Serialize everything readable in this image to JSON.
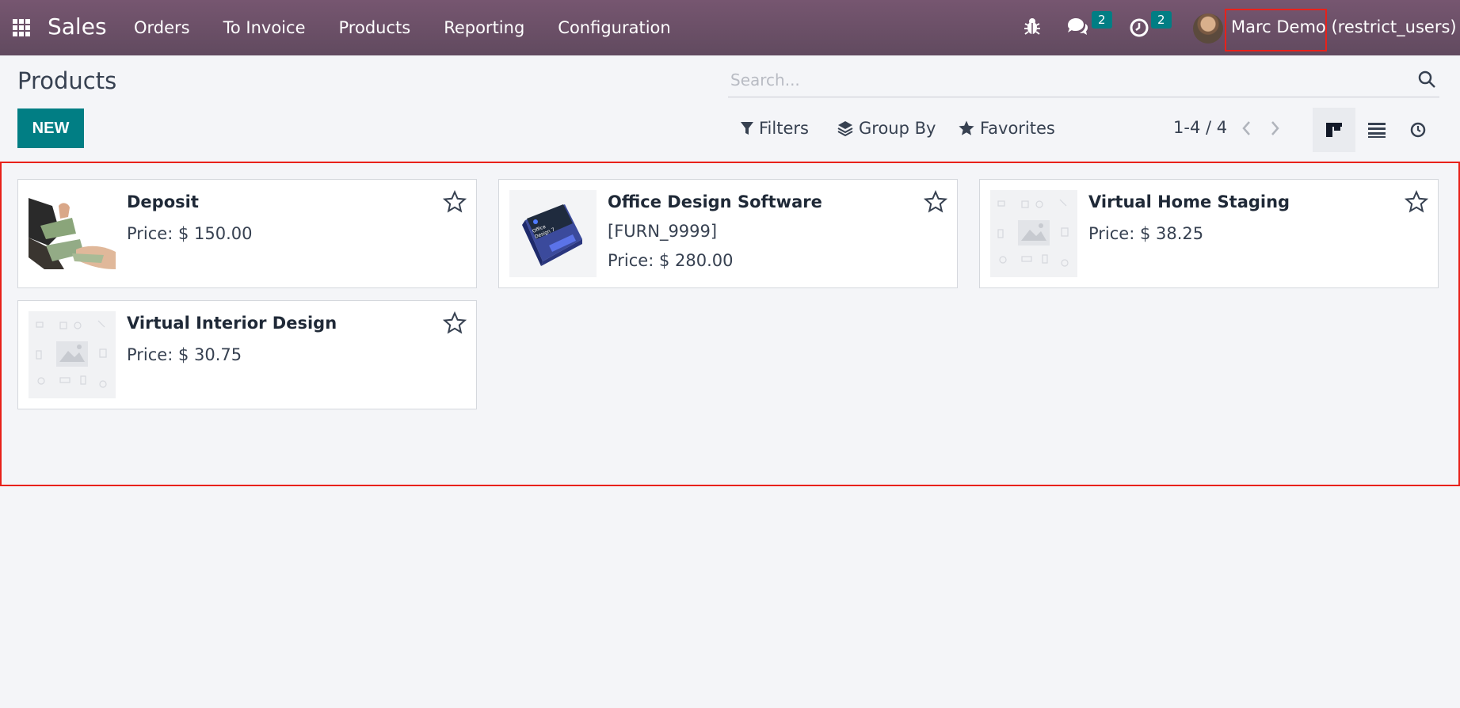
{
  "navbar": {
    "app_name": "Sales",
    "menu": [
      "Orders",
      "To Invoice",
      "Products",
      "Reporting",
      "Configuration"
    ],
    "messages_count": "2",
    "activities_count": "2",
    "user_name": "Marc Demo (restrict_users)"
  },
  "control_panel": {
    "title": "Products",
    "new_label": "NEW",
    "search_placeholder": "Search...",
    "filters_label": "Filters",
    "group_by_label": "Group By",
    "favorites_label": "Favorites",
    "pager": "1-4 / 4"
  },
  "products": [
    {
      "name": "Deposit",
      "ref": "",
      "price": "Price: $ 150.00",
      "image": "money-photo"
    },
    {
      "name": "Office Design Software",
      "ref": "[FURN_9999]",
      "price": "Price: $ 280.00",
      "image": "software-box"
    },
    {
      "name": "Virtual Home Staging",
      "ref": "",
      "price": "Price: $ 38.25",
      "image": "placeholder"
    },
    {
      "name": "Virtual Interior Design",
      "ref": "",
      "price": "Price: $ 30.75",
      "image": "placeholder"
    }
  ],
  "colors": {
    "navbar": "#6b4f67",
    "primary": "#017e84",
    "highlight": "#e8211a"
  }
}
